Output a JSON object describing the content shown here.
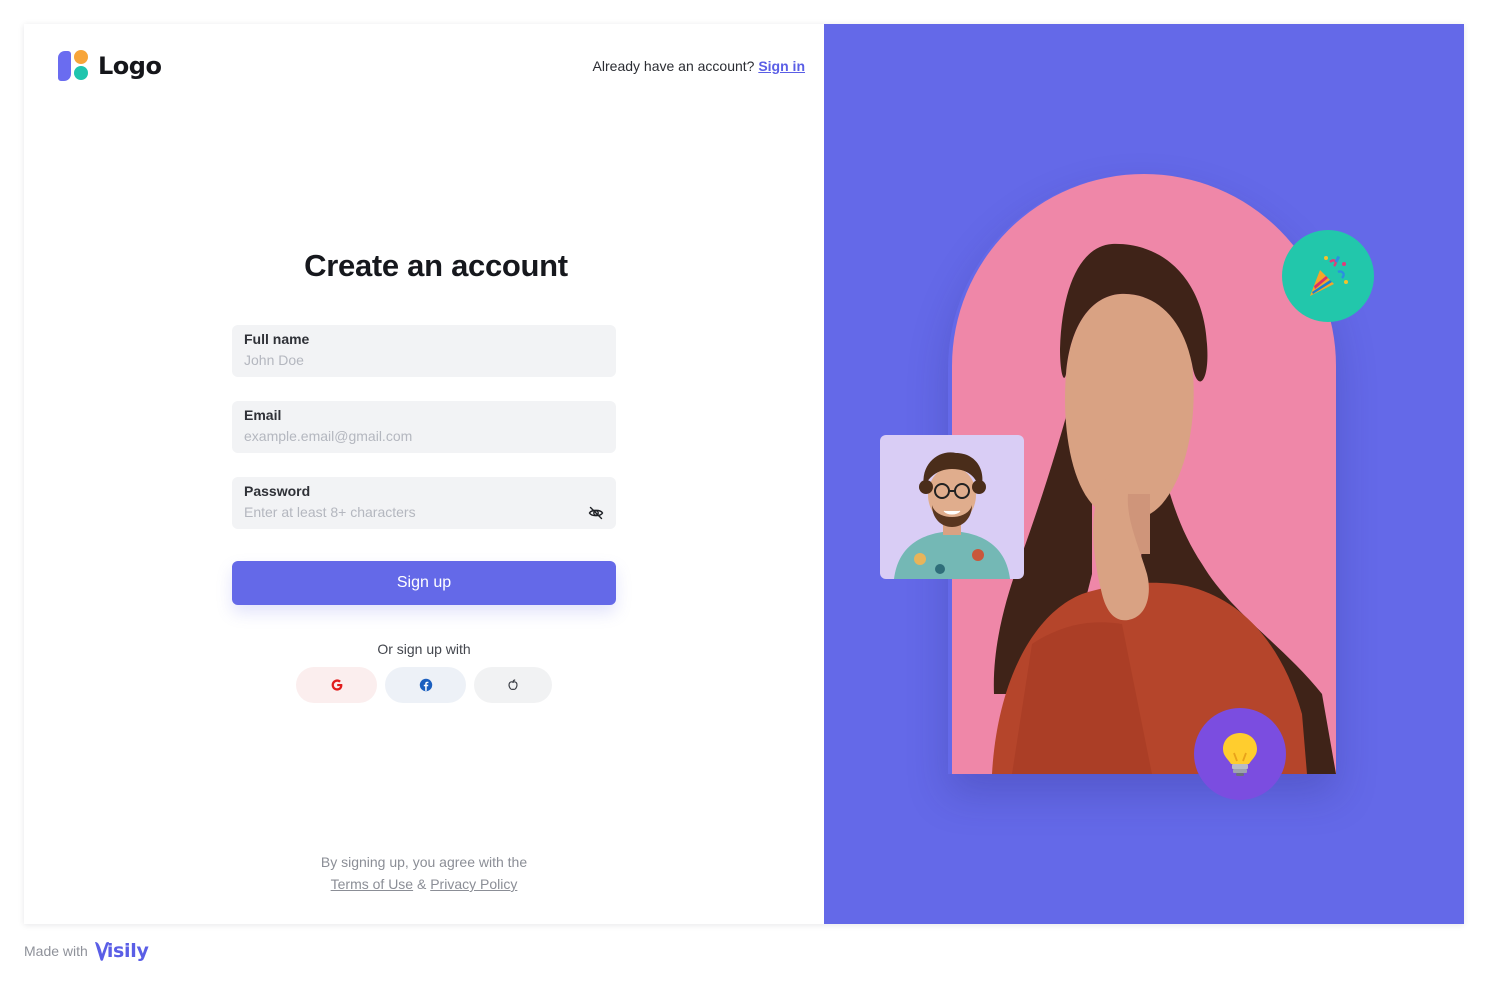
{
  "header": {
    "logo_text": "Logo",
    "signin_prompt": "Already have an account?",
    "signin_link": "Sign in"
  },
  "form": {
    "title": "Create an account",
    "fields": [
      {
        "label": "Full name",
        "placeholder": "John Doe",
        "value": ""
      },
      {
        "label": "Email",
        "placeholder": "example.email@gmail.com",
        "value": ""
      },
      {
        "label": "Password",
        "placeholder": "Enter at least 8+ characters",
        "value": ""
      }
    ],
    "submit_label": "Sign up",
    "social_prompt": "Or sign up with",
    "social_providers": [
      "google-icon",
      "facebook-icon",
      "apple-icon"
    ]
  },
  "terms": {
    "text": "By signing up, you agree with the",
    "terms_link": "Terms of Use",
    "separator": "&",
    "privacy_link": "Privacy Policy"
  },
  "footer": {
    "made_with": "Made with",
    "brand": "Visily"
  },
  "colors": {
    "accent": "#6469e8",
    "panel_bg": "#6469e8",
    "arch": "#ef87a8",
    "party_badge": "#22c7ab",
    "bulb_badge": "#7b4de0",
    "card_bg": "#d9cdf5",
    "field_bg": "#f2f3f5"
  }
}
